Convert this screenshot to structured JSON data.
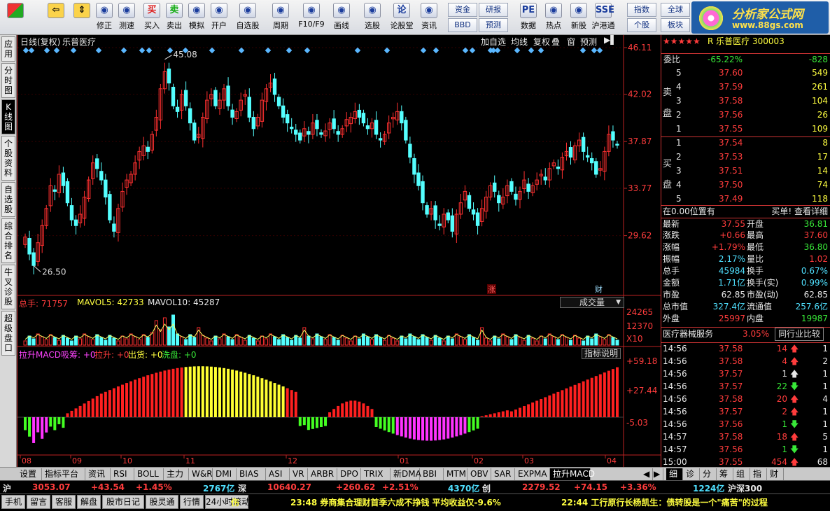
{
  "toolbar": {
    "buttons": [
      {
        "label": "",
        "icon": "grid-icon"
      },
      {
        "label": "",
        "icon": "back-arrow-icon"
      },
      {
        "label": "",
        "icon": "up-down-arrow-icon"
      },
      {
        "label": "修正",
        "icon": "refresh-icon"
      },
      {
        "label": "测速",
        "icon": "clock-icon"
      },
      {
        "label": "买入",
        "icon": "buy-icon",
        "glyph": "买"
      },
      {
        "label": "卖出",
        "icon": "sell-icon",
        "glyph": "卖"
      },
      {
        "label": "模拟",
        "icon": "hammer-icon"
      },
      {
        "label": "开户",
        "icon": "lock-icon"
      },
      {
        "label": "自选股",
        "icon": "star-icon"
      },
      {
        "label": "周期",
        "icon": "period-icon"
      },
      {
        "label": "F10/F9",
        "icon": "f10-icon"
      },
      {
        "label": "画线",
        "icon": "pen-icon"
      },
      {
        "label": "选股",
        "icon": "filter-icon"
      },
      {
        "label": "论股堂",
        "icon": "forum-icon",
        "glyph": "论"
      },
      {
        "label": "资讯",
        "icon": "news-icon"
      },
      {
        "label": "数据",
        "icon": "pe-icon",
        "glyph": "PE"
      },
      {
        "label": "热点",
        "icon": "fire-icon"
      },
      {
        "label": "新股",
        "icon": "new-stock-icon"
      },
      {
        "label": "沪港通",
        "icon": "hk-icon",
        "glyph": "SSE"
      }
    ],
    "small": [
      "资金",
      "研报",
      "BBD",
      "预测",
      "指数",
      "全球",
      "个股",
      "板块"
    ],
    "logo_title": "分析家公式网",
    "logo_url_text": "www.88gs.com"
  },
  "left_tabs": [
    "应用",
    "分时图",
    "K线图",
    "个股资料",
    "自选股",
    "综合排名",
    "牛叉诊股",
    "超级盘口"
  ],
  "chart": {
    "header_left": "日线(复权)",
    "stock_name": "乐普医疗",
    "header_buttons": [
      "加自选",
      "均线",
      "复权",
      "叠",
      "窗",
      "预测"
    ],
    "price_ticks": [
      "46.11",
      "42.02",
      "37.87",
      "33.77",
      "29.62"
    ],
    "high_label": "45.08",
    "low_label": "26.50",
    "markers": [
      "涨",
      "财"
    ],
    "vol_label_total": "总手: 71757",
    "vol_label_ma5": "MAVOL5: 42733",
    "vol_label_ma10": "MAVOL10: 45287",
    "vol_selector": "成交量",
    "vol_ticks": [
      "24265",
      "12370",
      "X10"
    ],
    "macd_labels": [
      "拉升MACD",
      "吸筹: +0",
      "拉升: +0",
      "出货: +0",
      "洗盘: +0"
    ],
    "macd_button": "指标说明",
    "macd_ticks": [
      "+59.18",
      "+27.44",
      "-5.03"
    ],
    "months": [
      "08",
      "09",
      "10",
      "11",
      "12",
      "01",
      "02",
      "03",
      "04"
    ],
    "up_color": "#ff3030",
    "down_color": "#54ffff"
  },
  "bottom_tabs": [
    "设置",
    "指标平台",
    "资讯",
    "RSI",
    "BOLL",
    "主力",
    "W&R",
    "DMI",
    "BIAS",
    "ASI",
    "VR",
    "ARBR",
    "DPO",
    "TRIX",
    "新DMA",
    "BBI",
    "MTM",
    "OBV",
    "SAR",
    "EXPMA",
    "拉升MACD"
  ],
  "right_tabs": [
    "细",
    "诊",
    "分",
    "筹",
    "组",
    "指",
    "财"
  ],
  "index_bar": {
    "sh_label": "沪",
    "sh_value": "3053.07",
    "sh_change": "+43.54",
    "sh_pct": "+1.45%",
    "sh_amount": "2767亿",
    "sz_label": "深",
    "sz_value": "10640.27",
    "sz_change": "+260.62",
    "sz_pct": "+2.51%",
    "sz_amount": "4370亿",
    "cy_label": "创",
    "cy_value": "2279.52",
    "cy_change": "+74.15",
    "cy_pct": "+3.36%",
    "hs_amount": "1224亿",
    "hs_label": "沪深300"
  },
  "ticker": {
    "buttons": [
      "手机",
      "留言",
      "客服",
      "解盘",
      "股市日记",
      "股灵通",
      "行情",
      "24小时滚动"
    ],
    "news1": "23:48 券商集合理财首季六成不挣钱 平均收益仅-9.6%",
    "news2": "22:44 工行原行长杨凯生：债转股是一个\"痛苦\"的过程",
    "prefix": "伤"
  },
  "quote": {
    "stars": "★★★★★",
    "code_name": "R 乐普医疗 300003",
    "wei_bi_label": "委比",
    "wei_bi": "-65.22%",
    "wei_cha": "-828",
    "sell_label": "卖盘",
    "buy_label": "买盘",
    "sell": [
      {
        "lv": "5",
        "price": "37.60",
        "vol": "549"
      },
      {
        "lv": "4",
        "price": "37.59",
        "vol": "261"
      },
      {
        "lv": "3",
        "price": "37.58",
        "vol": "104"
      },
      {
        "lv": "2",
        "price": "37.56",
        "vol": "26"
      },
      {
        "lv": "1",
        "price": "37.55",
        "vol": "109"
      }
    ],
    "buy": [
      {
        "lv": "1",
        "price": "37.54",
        "vol": "8"
      },
      {
        "lv": "2",
        "price": "37.53",
        "vol": "17"
      },
      {
        "lv": "3",
        "price": "37.51",
        "vol": "14"
      },
      {
        "lv": "4",
        "price": "37.50",
        "vol": "74"
      },
      {
        "lv": "5",
        "price": "37.49",
        "vol": "118"
      }
    ],
    "pos_text": "在0.00位置有",
    "buy_link": "买单! 查看详细",
    "stats": [
      {
        "l1": "最新",
        "v1": "37.55",
        "c1": "red",
        "l2": "开盘",
        "v2": "36.81",
        "c2": "green"
      },
      {
        "l1": "涨跌",
        "v1": "+0.66",
        "c1": "red",
        "l2": "最高",
        "v2": "37.60",
        "c2": "red"
      },
      {
        "l1": "涨幅",
        "v1": "+1.79%",
        "c1": "red",
        "l2": "最低",
        "v2": "36.80",
        "c2": "green"
      },
      {
        "l1": "振幅",
        "v1": "2.17%",
        "c1": "cyan",
        "l2": "量比",
        "v2": "1.02",
        "c2": "red"
      },
      {
        "l1": "总手",
        "v1": "45984",
        "c1": "cyan",
        "l2": "换手",
        "v2": "0.67%",
        "c2": "cyan"
      },
      {
        "l1": "金额",
        "v1": "1.71亿",
        "c1": "cyan",
        "l2": "换手(实)",
        "v2": "0.99%",
        "c2": "cyan"
      },
      {
        "l1": "市盈",
        "v1": "62.85",
        "c1": "wht",
        "l2": "市盈(动)",
        "v2": "62.85",
        "c2": "wht"
      },
      {
        "l1": "总市值",
        "v1": "327.4亿",
        "c1": "cyan",
        "l2": "流通值",
        "v2": "257.6亿",
        "c2": "cyan"
      },
      {
        "l1": "外盘",
        "v1": "25997",
        "c1": "red",
        "l2": "内盘",
        "v2": "19987",
        "c2": "green"
      }
    ],
    "industry": "医疗器械服务",
    "industry_pct": "3.05%",
    "industry_btn": "同行业比较",
    "ticks": [
      {
        "t": "14:56",
        "p": "37.58",
        "v": "14",
        "d": "up",
        "n": "1"
      },
      {
        "t": "14:56",
        "p": "37.58",
        "v": "4",
        "d": "up",
        "n": "2"
      },
      {
        "t": "14:56",
        "p": "37.57",
        "v": "1",
        "d": "flat",
        "n": "1"
      },
      {
        "t": "14:56",
        "p": "37.57",
        "v": "22",
        "d": "down",
        "n": "1"
      },
      {
        "t": "14:56",
        "p": "37.58",
        "v": "20",
        "d": "up",
        "n": "4"
      },
      {
        "t": "14:56",
        "p": "37.57",
        "v": "2",
        "d": "up",
        "n": "1"
      },
      {
        "t": "14:56",
        "p": "37.56",
        "v": "1",
        "d": "down",
        "n": "1"
      },
      {
        "t": "14:57",
        "p": "37.58",
        "v": "18",
        "d": "up",
        "n": "5"
      },
      {
        "t": "14:57",
        "p": "37.56",
        "v": "1",
        "d": "down",
        "n": "1"
      },
      {
        "t": "15:00",
        "p": "37.55",
        "v": "454",
        "d": "up",
        "n": "68"
      }
    ]
  },
  "chart_data": {
    "type": "candlestick",
    "title": "乐普医疗 日线(复权)",
    "x_months": [
      "08",
      "09",
      "10",
      "11",
      "12",
      "01",
      "02",
      "03",
      "04"
    ],
    "ylim": [
      24.5,
      46.11
    ],
    "y_ticks": [
      46.11,
      42.02,
      37.87,
      33.77,
      29.62
    ],
    "high": 45.08,
    "low": 26.5,
    "close_path": [
      29.5,
      28.0,
      27.0,
      29.0,
      30.5,
      32.0,
      34.0,
      33.5,
      35.0,
      34.0,
      32.5,
      31.0,
      30.5,
      31.5,
      33.0,
      34.5,
      36.0,
      35.5,
      34.5,
      33.0,
      31.0,
      30.0,
      32.0,
      33.5,
      34.5,
      35.0,
      36.0,
      37.0,
      37.5,
      37.0,
      38.5,
      40.0,
      42.5,
      44.0,
      43.0,
      41.0,
      40.5,
      42.0,
      41.0,
      39.5,
      38.0,
      38.5,
      40.0,
      41.5,
      42.0,
      41.0,
      41.5,
      42.5,
      41.0,
      40.0,
      40.5,
      41.5,
      42.0,
      40.0,
      39.0,
      40.0,
      41.5,
      42.5,
      43.0,
      42.0,
      41.0,
      40.0,
      39.5,
      39.0,
      38.5,
      38.0,
      39.0,
      38.5,
      39.5,
      39.0,
      38.5,
      38.8,
      39.5,
      39.0,
      38.5,
      39.0,
      39.8,
      40.0,
      40.5,
      40.0,
      39.5,
      39.0,
      39.5,
      38.5,
      38.0,
      38.5,
      39.5,
      40.0,
      40.5,
      39.5,
      38.0,
      36.5,
      35.0,
      34.0,
      32.5,
      31.5,
      32.0,
      31.0,
      30.5,
      31.5,
      31.0,
      30.0,
      31.5,
      32.5,
      33.5,
      32.0,
      31.5,
      30.5,
      32.0,
      33.0,
      34.0,
      33.5,
      32.5,
      33.0,
      34.0,
      33.5,
      32.8,
      33.5,
      34.5,
      33.5,
      34.0,
      34.5,
      35.0,
      34.5,
      35.5,
      36.0,
      35.5,
      36.5,
      37.0,
      36.5,
      37.5,
      38.0,
      37.0,
      36.5,
      36.0,
      35.0,
      35.5,
      37.0,
      38.5,
      38.0,
      37.55
    ],
    "volume_ticks": [
      24265,
      12370
    ],
    "volume_unit": "X10",
    "mavol5": 42733,
    "mavol10": 45287,
    "total_volume": 71757,
    "macd_ticks": [
      59.18,
      27.44,
      -5.03
    ],
    "macd_series_note": "bars colored green/magenta/red/yellow"
  }
}
